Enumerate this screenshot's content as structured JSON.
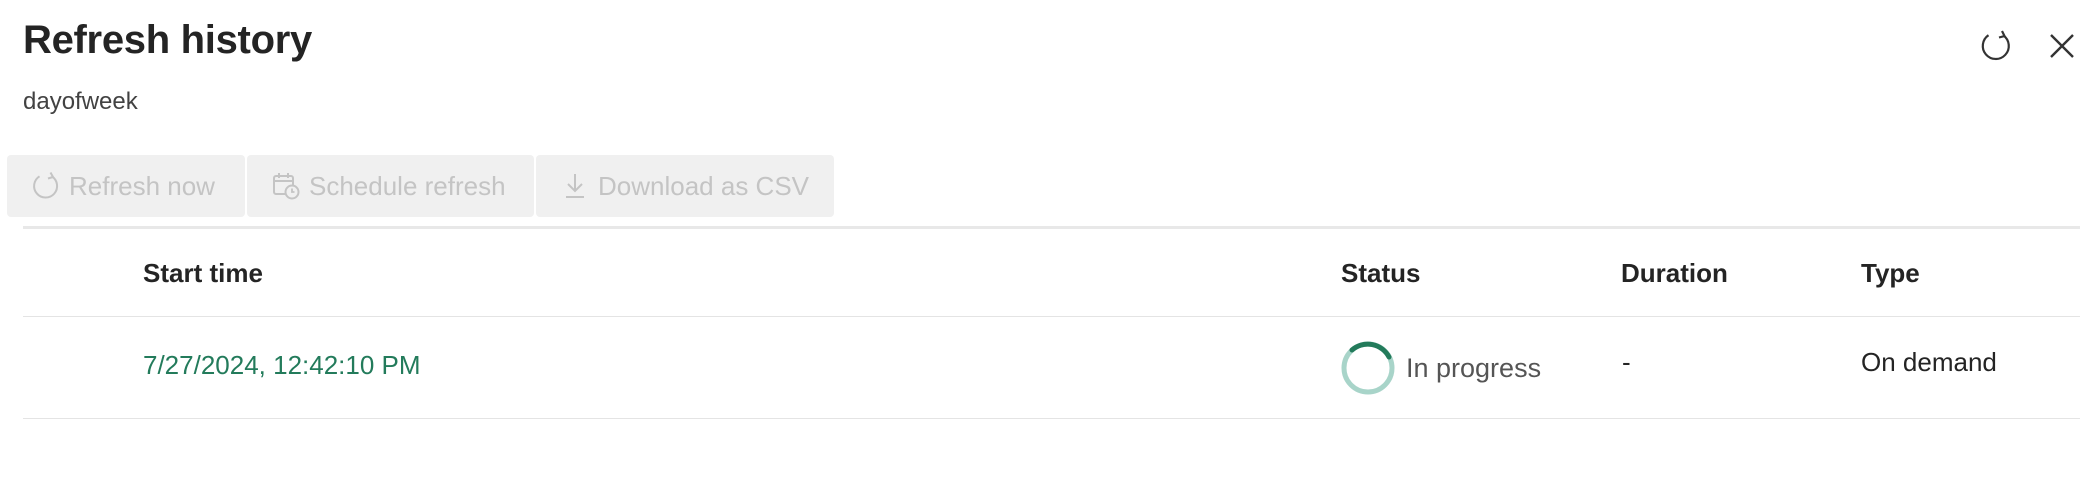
{
  "header": {
    "title": "Refresh history",
    "subtitle": "dayofweek",
    "refresh_icon": "refresh-icon",
    "close_icon": "close-icon"
  },
  "toolbar": {
    "refresh_now": "Refresh now",
    "schedule_refresh": "Schedule refresh",
    "download_csv": "Download as CSV"
  },
  "table": {
    "columns": [
      "Start time",
      "Status",
      "Duration",
      "Type"
    ],
    "rows": [
      {
        "start_time": "7/27/2024, 12:42:10 PM",
        "status": "In progress",
        "duration": "-",
        "type": "On demand"
      }
    ]
  },
  "colors": {
    "accent": "#237b5b",
    "spinner_track": "#a8d4c9",
    "disabled_text": "#c4c4c4"
  }
}
